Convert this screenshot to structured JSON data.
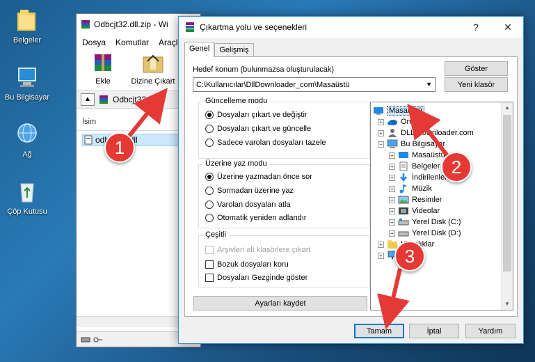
{
  "desktop": {
    "icons": [
      {
        "label": "Belgeler"
      },
      {
        "label": "Bu Bilgisayar"
      },
      {
        "label": "Ağ"
      },
      {
        "label": "Çöp Kutusu"
      }
    ]
  },
  "winrar": {
    "title": "Odbcjt32.dll.zip - Wi",
    "menu": [
      "Dosya",
      "Komutlar",
      "Araçla"
    ],
    "toolbar": {
      "add_label": "Ekle",
      "extract_label": "Dizine Çıkart"
    },
    "path": "Odbcjt32.dl",
    "column_name": "İsim",
    "file_name": "odbcjt32.dll"
  },
  "dialog": {
    "title": "Çıkartma yolu ve seçenekleri",
    "tabs": [
      "Genel",
      "Gelişmiş"
    ],
    "dest_label": "Hedef konum (bulunmazsa oluşturulacak)",
    "dest_value": "C:\\Kullanıcılar\\DllDownloader_com\\Masaüstü",
    "show_button": "Göster",
    "new_folder_button": "Yeni klasör",
    "update_mode": {
      "title": "Güncelleme modu",
      "options": [
        "Dosyaları çıkart ve değiştir",
        "Dosyaları çıkart ve güncelle",
        "Sadece varolan dosyaları tazele"
      ],
      "selected": 0
    },
    "overwrite_mode": {
      "title": "Üzerine yaz modu",
      "options": [
        "Üzerine yazmadan önce sor",
        "Sormadan üzerine yaz",
        "Varolan dosyaları atla",
        "Otomatik yeniden adlandır"
      ],
      "selected": 0
    },
    "misc": {
      "title": "Çeşitli",
      "options": [
        "Arşivleri alt klasörlere çıkart",
        "Bozuk dosyaları koru",
        "Dosyaları Gezginde göster"
      ]
    },
    "save_settings_button": "Ayarları kaydet",
    "tree": [
      {
        "label": "Masaüstü",
        "selected": true
      },
      {
        "label": "OneDrive"
      },
      {
        "label": "DLL Downloader.com"
      },
      {
        "label": "Bu Bilgisayar"
      },
      {
        "label": "Masaüstü"
      },
      {
        "label": "Belgeler"
      },
      {
        "label": "İndirilenler"
      },
      {
        "label": "Müzik"
      },
      {
        "label": "Resimler"
      },
      {
        "label": "Videolar"
      },
      {
        "label": "Yerel Disk (C:)"
      },
      {
        "label": "Yerel Disk (D:)"
      },
      {
        "label": "Kitaplıklar"
      },
      {
        "label": "Ağ"
      }
    ],
    "ok_button": "Tamam",
    "cancel_button": "İptal",
    "help_button": "Yardım",
    "help_title_glyph": "?",
    "close_title_glyph": "✕"
  },
  "annotations": {
    "step1": "1",
    "step2": "2",
    "step3": "3",
    "color": "#e53935"
  }
}
